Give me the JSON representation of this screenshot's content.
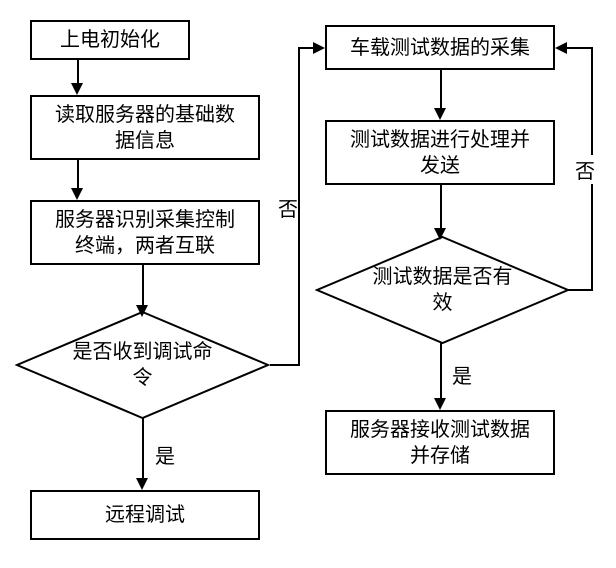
{
  "nodes": {
    "init": "上电初始化",
    "read_base": "读取服务器的基础数\n据信息",
    "server_identify": "服务器识别采集控制\n终端，两者互联",
    "debug_cmd": "是否收到调试命\n令",
    "remote_debug": "远程调试",
    "collect": "车载测试数据的采集",
    "process_send": "测试数据进行处理并\n发送",
    "valid_check": "测试数据是否有\n效",
    "store": "服务器接收测试数据\n并存储"
  },
  "labels": {
    "yes": "是",
    "no": "否"
  }
}
